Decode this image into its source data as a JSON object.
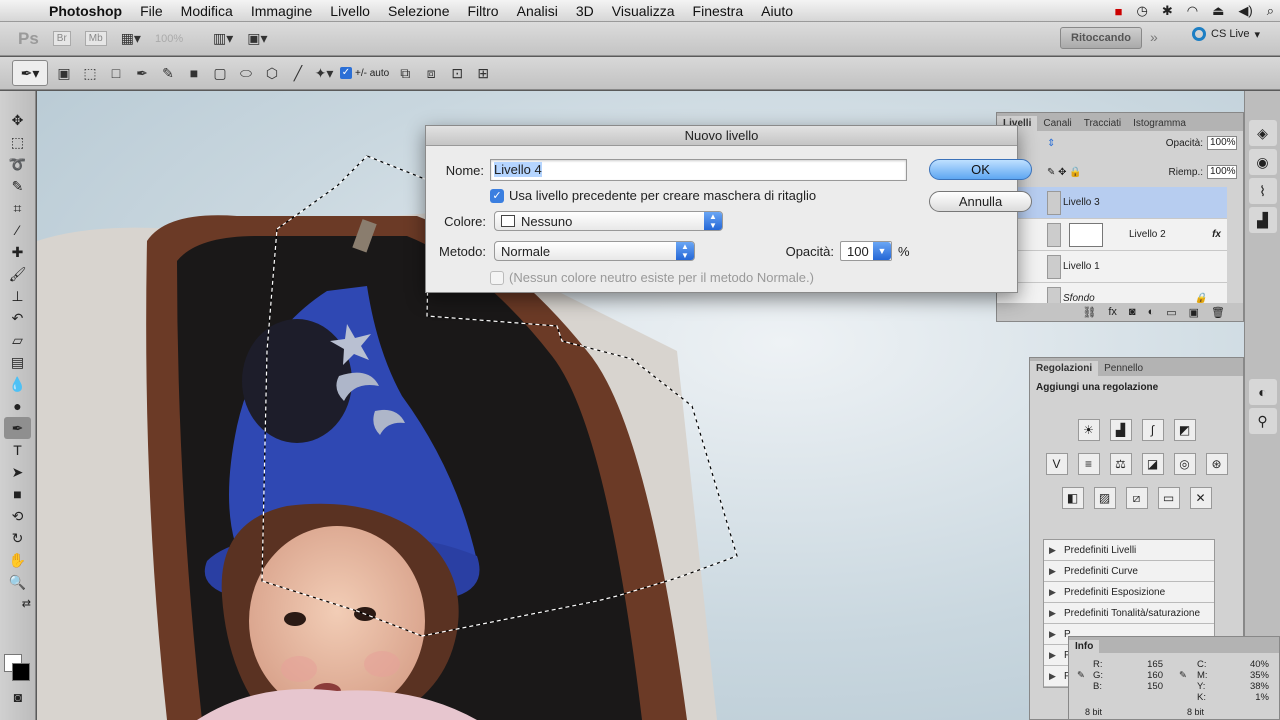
{
  "menubar": {
    "app": "Photoshop",
    "items": [
      "File",
      "Modifica",
      "Immagine",
      "Livello",
      "Selezione",
      "Filtro",
      "Analisi",
      "3D",
      "Visualizza",
      "Finestra",
      "Aiuto"
    ]
  },
  "appbar": {
    "ps_logo": "Ps",
    "zoom": "100%",
    "workspace": "Ritoccando",
    "cs_live": "CS Live"
  },
  "options": {
    "auto_add_delete": "+/- auto"
  },
  "layers_panel": {
    "tabs": [
      "Livelli",
      "Canali",
      "Tracciati",
      "Istogramma"
    ],
    "opacity_label": "Opacità:",
    "opacity_value": "100%",
    "fill_label": "Riemp.:",
    "fill_value": "100%",
    "layers": [
      {
        "name": "Livello 3",
        "selected": true
      },
      {
        "name": "Livello 2",
        "selected": false
      },
      {
        "name": "Livello 1",
        "selected": false
      },
      {
        "name": "Sfondo",
        "selected": false
      }
    ],
    "fx_badge": "fx"
  },
  "adjustments_panel": {
    "tabs": [
      "Regolazioni",
      "Pennello"
    ],
    "hint": "Aggiungi una regolazione",
    "presets": [
      "Predefiniti Livelli",
      "Predefiniti Curve",
      "Predefiniti Esposizione",
      "Predefiniti Tonalità/saturazione",
      "P",
      "P",
      "P"
    ]
  },
  "info_panel": {
    "tab": "Info",
    "rgb": [
      {
        "k": "R:",
        "v": "165"
      },
      {
        "k": "G:",
        "v": "160"
      },
      {
        "k": "B:",
        "v": "150"
      }
    ],
    "cmyk": [
      {
        "k": "C:",
        "v": "40%"
      },
      {
        "k": "M:",
        "v": "35%"
      },
      {
        "k": "Y:",
        "v": "38%"
      },
      {
        "k": "K:",
        "v": "1%"
      }
    ],
    "bit_left": "8 bit",
    "bit_right": "8 bit"
  },
  "dialog": {
    "title": "Nuovo livello",
    "name_label": "Nome:",
    "name_value": "Livello 4",
    "clip_label": "Usa livello precedente per creare maschera di ritaglio",
    "color_label": "Colore:",
    "color_value": "Nessuno",
    "mode_label": "Metodo:",
    "mode_value": "Normale",
    "opacity_label": "Opacità:",
    "opacity_value": "100",
    "opacity_unit": "%",
    "neutral_label": "(Nessun colore neutro esiste per il metodo Normale.)",
    "ok": "OK",
    "cancel": "Annulla"
  }
}
